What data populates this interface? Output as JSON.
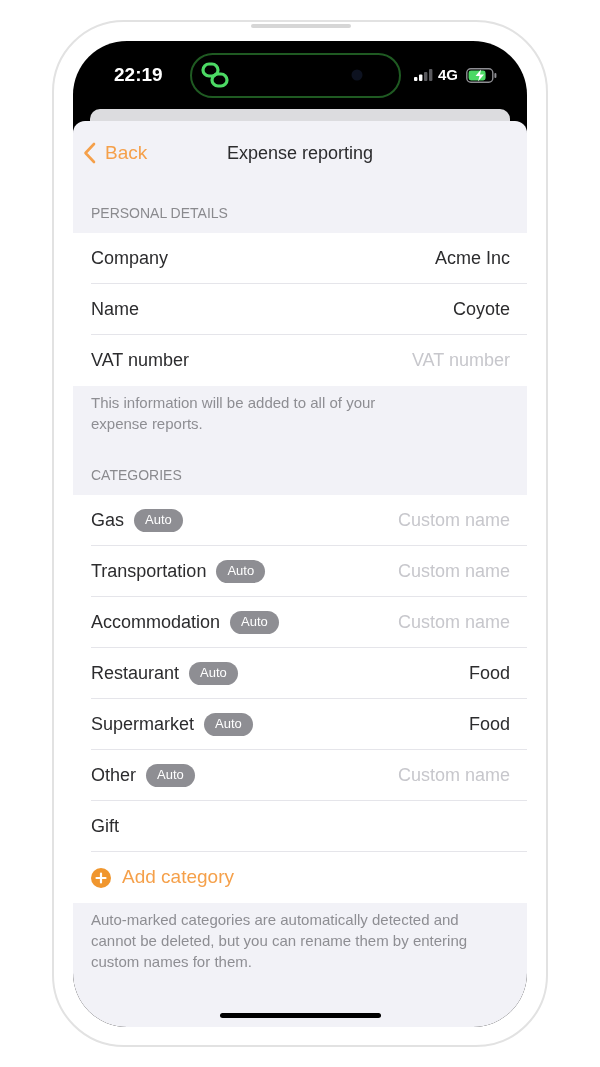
{
  "status_bar": {
    "time": "22:19",
    "network": "4G"
  },
  "nav": {
    "back": "Back",
    "title": "Expense reporting"
  },
  "personal_details": {
    "header": "PERSONAL DETAILS",
    "rows": [
      {
        "label": "Company",
        "value": "Acme Inc"
      },
      {
        "label": "Name",
        "value": "Coyote"
      },
      {
        "label": "VAT number",
        "placeholder": "VAT number"
      }
    ],
    "footer": "This information will be added to all of your expense reports."
  },
  "categories": {
    "header": "CATEGORIES",
    "rows": [
      {
        "label": "Gas",
        "badge": "Auto",
        "placeholder": "Custom name"
      },
      {
        "label": "Transportation",
        "badge": "Auto",
        "placeholder": "Custom name"
      },
      {
        "label": "Accommodation",
        "badge": "Auto",
        "placeholder": "Custom name"
      },
      {
        "label": "Restaurant",
        "badge": "Auto",
        "value": "Food"
      },
      {
        "label": "Supermarket",
        "badge": "Auto",
        "value": "Food"
      },
      {
        "label": "Other",
        "badge": "Auto",
        "placeholder": "Custom name"
      },
      {
        "label": "Gift"
      }
    ],
    "add_button": "Add category",
    "footer": "Auto-marked categories are automatically detected and cannot be deleted, but you can rename them by entering custom names for them."
  }
}
